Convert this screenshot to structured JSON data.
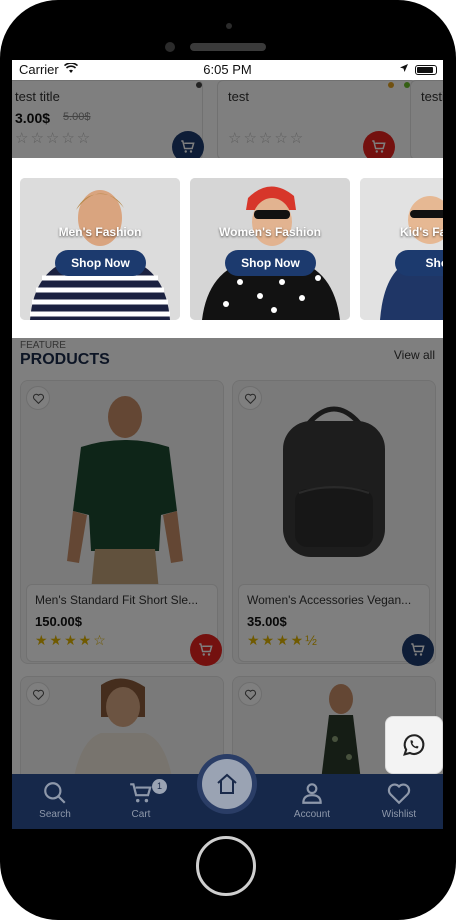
{
  "status": {
    "carrier": "Carrier",
    "time": "6:05 PM"
  },
  "top_products": [
    {
      "name": "test title",
      "price": "3.00$",
      "old_price": "5.00$",
      "stars": "☆☆☆☆☆"
    },
    {
      "name": "test",
      "stars": "☆☆☆☆☆"
    },
    {
      "name": "testi",
      "stars": ""
    }
  ],
  "categories": [
    {
      "label": "Men's Fashion",
      "button": "Shop Now"
    },
    {
      "label": "Women's Fashion",
      "button": "Shop Now"
    },
    {
      "label": "Kid's Fa",
      "button": "Shop"
    }
  ],
  "section": {
    "kicker": "FEATURE",
    "title": "PRODUCTS",
    "view_all": "View all"
  },
  "products": [
    {
      "name": "Men's Standard Fit Short Sle...",
      "price": "150.00$",
      "stars": "★★★★☆"
    },
    {
      "name": "Women's Accessories Vegan...",
      "price": "35.00$",
      "stars": "★★★★½"
    },
    {
      "name": "",
      "price": "",
      "stars": ""
    },
    {
      "name": "",
      "price": "",
      "stars": ""
    }
  ],
  "tabbar": {
    "search": "Search",
    "cart": "Cart",
    "account": "Account",
    "wishlist": "Wishlist",
    "cart_badge": "1"
  },
  "colors": {
    "navy": "#1c3a6e",
    "red": "#e8231f",
    "tabbar": "#16284a"
  }
}
